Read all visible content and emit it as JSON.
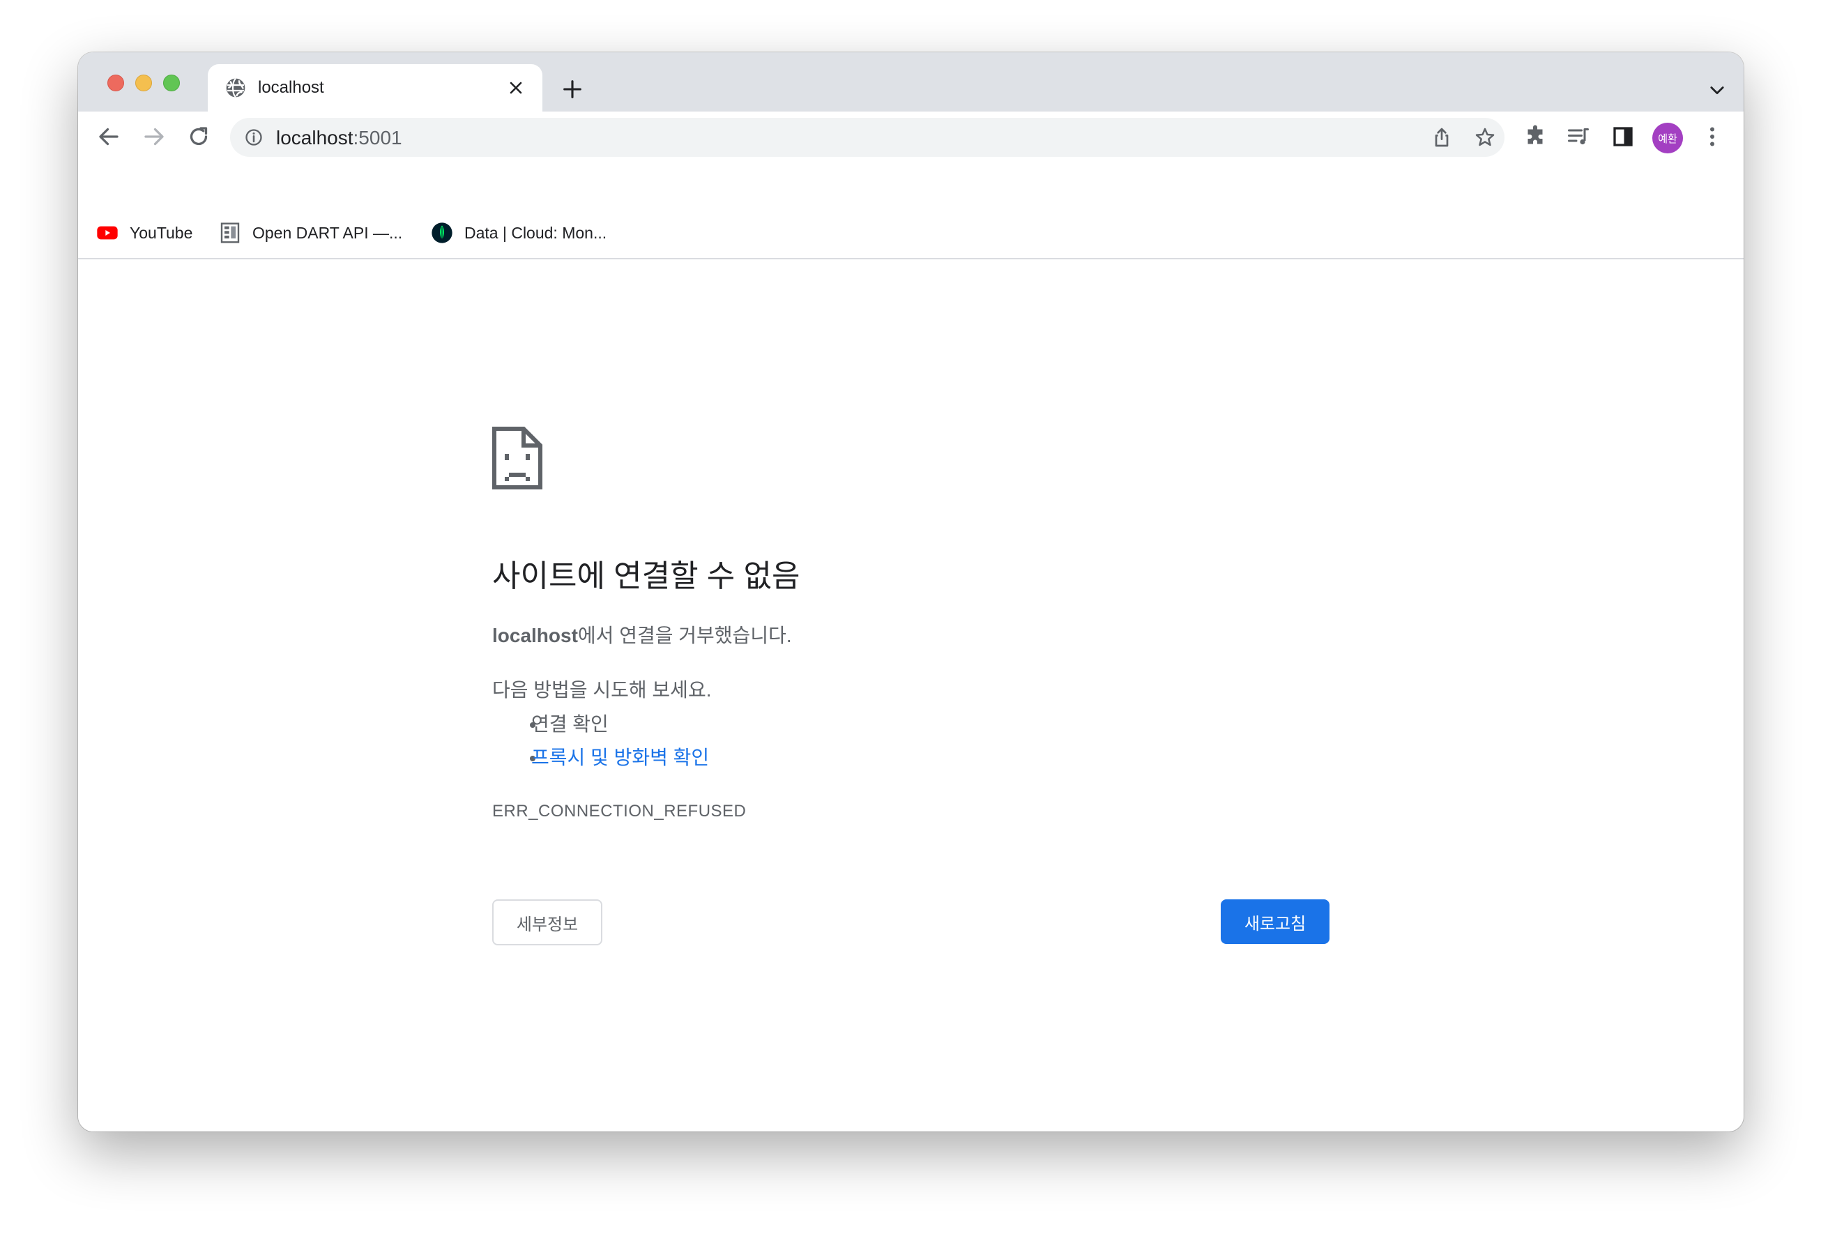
{
  "tab": {
    "title": "localhost"
  },
  "toolbar": {
    "url_host": "localhost",
    "url_port": ":5001",
    "profile_initials": "예환"
  },
  "bookmarks": [
    {
      "label": "YouTube",
      "icon": "youtube-icon"
    },
    {
      "label": "Open DART API —...",
      "icon": "dart-icon"
    },
    {
      "label": "Data | Cloud: Mon...",
      "icon": "mongodb-leaf-icon"
    }
  ],
  "error": {
    "title": "사이트에 연결할 수 없음",
    "host": "localhost",
    "desc_suffix": "에서 연결을 거부했습니다.",
    "try_text": "다음 방법을 시도해 보세요.",
    "suggestions": [
      {
        "label": "연결 확인",
        "link": false
      },
      {
        "label": "프록시 및 방화벽 확인",
        "link": true
      }
    ],
    "code": "ERR_CONNECTION_REFUSED",
    "details_label": "세부정보",
    "reload_label": "새로고침"
  },
  "colors": {
    "accent": "#1a73e8",
    "profile": "#a33fc2",
    "youtube": "#ff0000",
    "mongodb": "#00ed64"
  }
}
